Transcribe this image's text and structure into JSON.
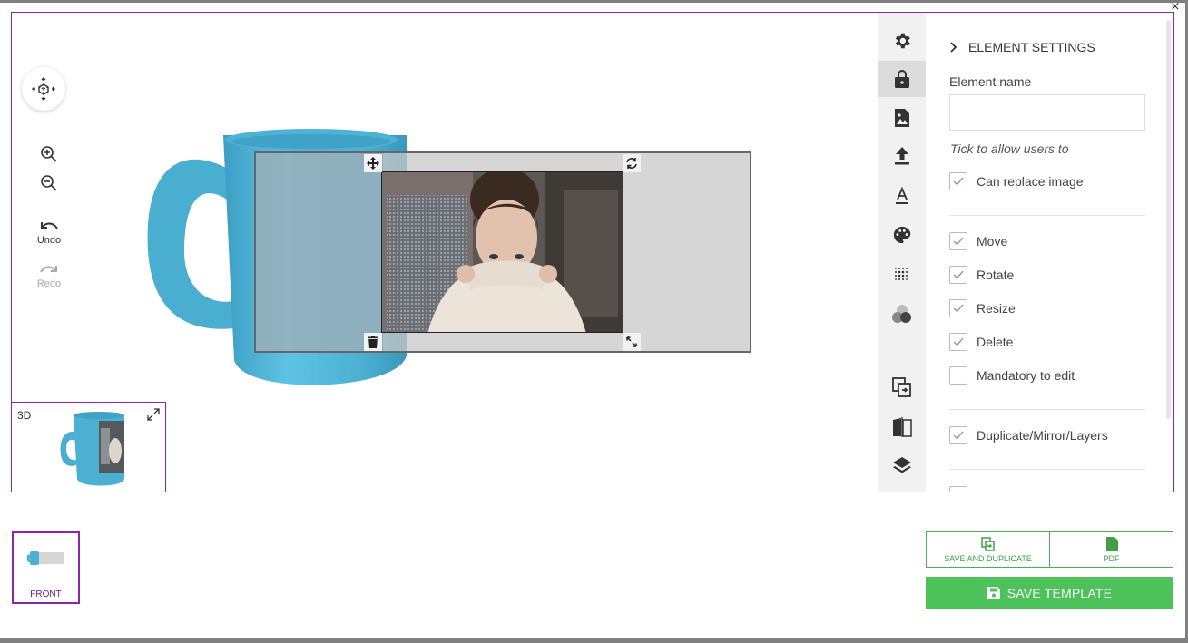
{
  "window": {
    "close_glyph": "×"
  },
  "canvas": {
    "undo_label": "Undo",
    "redo_label": "Redo",
    "preview3d_label": "3D",
    "colors": {
      "mug": "#4cb0d3",
      "accent_border": "#8e24aa"
    }
  },
  "sidebar_tabs": [
    {
      "icon": "gear-icon"
    },
    {
      "icon": "lock-icon",
      "active": true
    },
    {
      "icon": "image-icon"
    },
    {
      "icon": "upload-icon"
    },
    {
      "icon": "text-color-icon"
    },
    {
      "icon": "palette-icon"
    },
    {
      "icon": "halftone-icon"
    },
    {
      "icon": "color-circles-icon"
    },
    {
      "icon": "duplicate-icon"
    },
    {
      "icon": "mirror-icon"
    },
    {
      "icon": "layers-icon"
    }
  ],
  "settings": {
    "header": "ELEMENT SETTINGS",
    "element_name_label": "Element name",
    "element_name_value": "",
    "hint": "Tick to allow users to",
    "options": {
      "can_replace_image": "Can replace image",
      "move": "Move",
      "rotate": "Rotate",
      "resize": "Resize",
      "delete": "Delete",
      "mandatory_to_edit": "Mandatory to edit",
      "duplicate_mirror_layers": "Duplicate/Mirror/Layers"
    }
  },
  "pages": [
    {
      "label": "FRONT"
    }
  ],
  "actions": {
    "save_and_duplicate": "SAVE AND DUPLICATE",
    "pdf": "PDF",
    "save_template": "SAVE TEMPLATE"
  }
}
